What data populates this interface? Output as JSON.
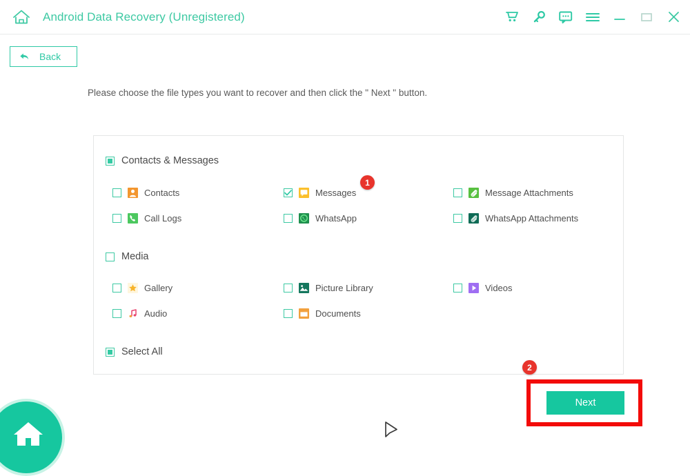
{
  "window": {
    "title": "Android Data Recovery (Unregistered)",
    "home_icon": "home-outline-icon",
    "accent_color": "#3dc9a3",
    "controls": [
      {
        "name": "cart-icon",
        "label": "Cart"
      },
      {
        "name": "key-icon",
        "label": "Register"
      },
      {
        "name": "feedback-icon",
        "label": "Feedback"
      },
      {
        "name": "menu-icon",
        "label": "Menu"
      },
      {
        "name": "minimize-icon",
        "label": "Minimize"
      },
      {
        "name": "maximize-icon",
        "label": "Maximize"
      },
      {
        "name": "close-icon",
        "label": "Close"
      }
    ]
  },
  "toolbar": {
    "back_label": "Back",
    "back_icon": "back-arrow-icon"
  },
  "instruction": "Please choose the file types you want to recover and then click the \" Next \" button.",
  "groups": [
    {
      "label": "Contacts & Messages",
      "state": "indeterminate",
      "items": [
        {
          "label": "Contacts",
          "icon": "contacts-icon",
          "checked": false
        },
        {
          "label": "Messages",
          "icon": "messages-icon",
          "checked": true
        },
        {
          "label": "Message Attachments",
          "icon": "message-attachments-icon",
          "checked": false
        },
        {
          "label": "Call Logs",
          "icon": "call-logs-icon",
          "checked": false
        },
        {
          "label": "WhatsApp",
          "icon": "whatsapp-icon",
          "checked": false
        },
        {
          "label": "WhatsApp Attachments",
          "icon": "whatsapp-attachments-icon",
          "checked": false
        }
      ]
    },
    {
      "label": "Media",
      "state": "unchecked",
      "items": [
        {
          "label": "Gallery",
          "icon": "gallery-icon",
          "checked": false
        },
        {
          "label": "Picture Library",
          "icon": "picture-library-icon",
          "checked": false
        },
        {
          "label": "Videos",
          "icon": "videos-icon",
          "checked": false
        },
        {
          "label": "Audio",
          "icon": "audio-icon",
          "checked": false
        },
        {
          "label": "Documents",
          "icon": "documents-icon",
          "checked": false
        }
      ]
    }
  ],
  "select_all": {
    "label": "Select All",
    "state": "indeterminate"
  },
  "badges": [
    {
      "text": "1",
      "for": "messages-checkbox"
    },
    {
      "text": "2",
      "for": "next-button"
    }
  ],
  "next_button": {
    "label": "Next",
    "background": "#16c79f",
    "highlight_color": "#f30b09"
  },
  "home_button": {
    "icon": "home-filled-icon",
    "color": "#16c79f"
  },
  "cursor": {
    "icon": "pointer-arrow-icon"
  }
}
